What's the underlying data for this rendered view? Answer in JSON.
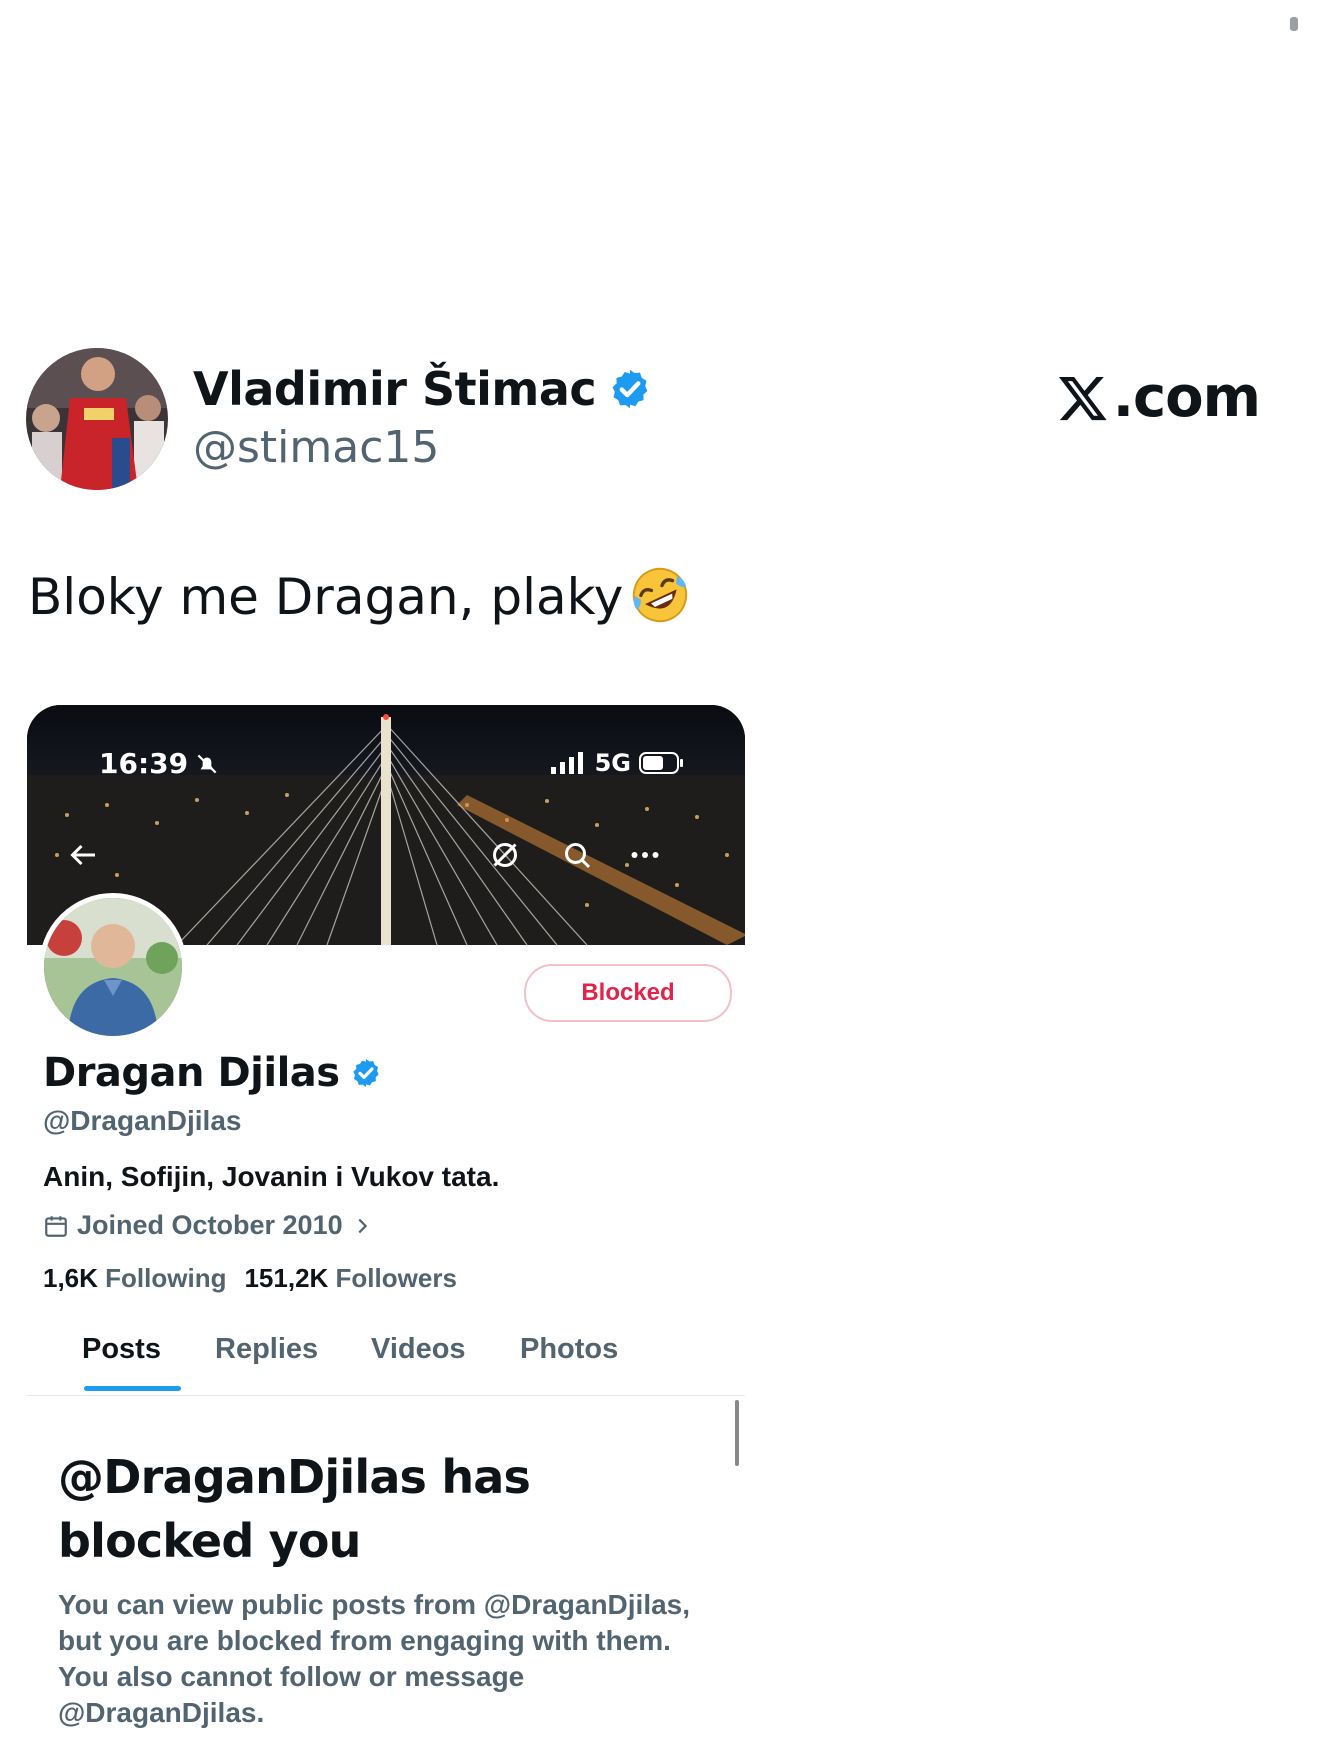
{
  "tweet": {
    "author_name": "Vladimir Štimac",
    "author_handle": "@stimac15",
    "text": "Bloky me Dragan, plaky",
    "emoji": "rolling-on-the-floor-laughing-emoji"
  },
  "brand": {
    "label": ".com"
  },
  "colors": {
    "verified": "#1d9bf0",
    "blocked": "#e0244a",
    "muted": "#536471"
  },
  "embedded_profile": {
    "status_bar": {
      "time": "16:39",
      "network": "5G"
    },
    "name": "Dragan Djilas",
    "handle": "@DraganDjilas",
    "bio": "Anin, Sofijin, Jovanin i Vukov tata.",
    "joined": "Joined October 2010",
    "following_count": "1,6K",
    "following_label": "Following",
    "followers_count": "151,2K",
    "followers_label": "Followers",
    "blocked_button": "Blocked",
    "tabs": [
      "Posts",
      "Replies",
      "Videos",
      "Photos"
    ],
    "blocked_title": "@DraganDjilas has blocked you",
    "blocked_body": "You can view public posts from @DraganDjilas, but you are blocked from engaging with them. You also cannot follow or message @DraganDjilas."
  }
}
